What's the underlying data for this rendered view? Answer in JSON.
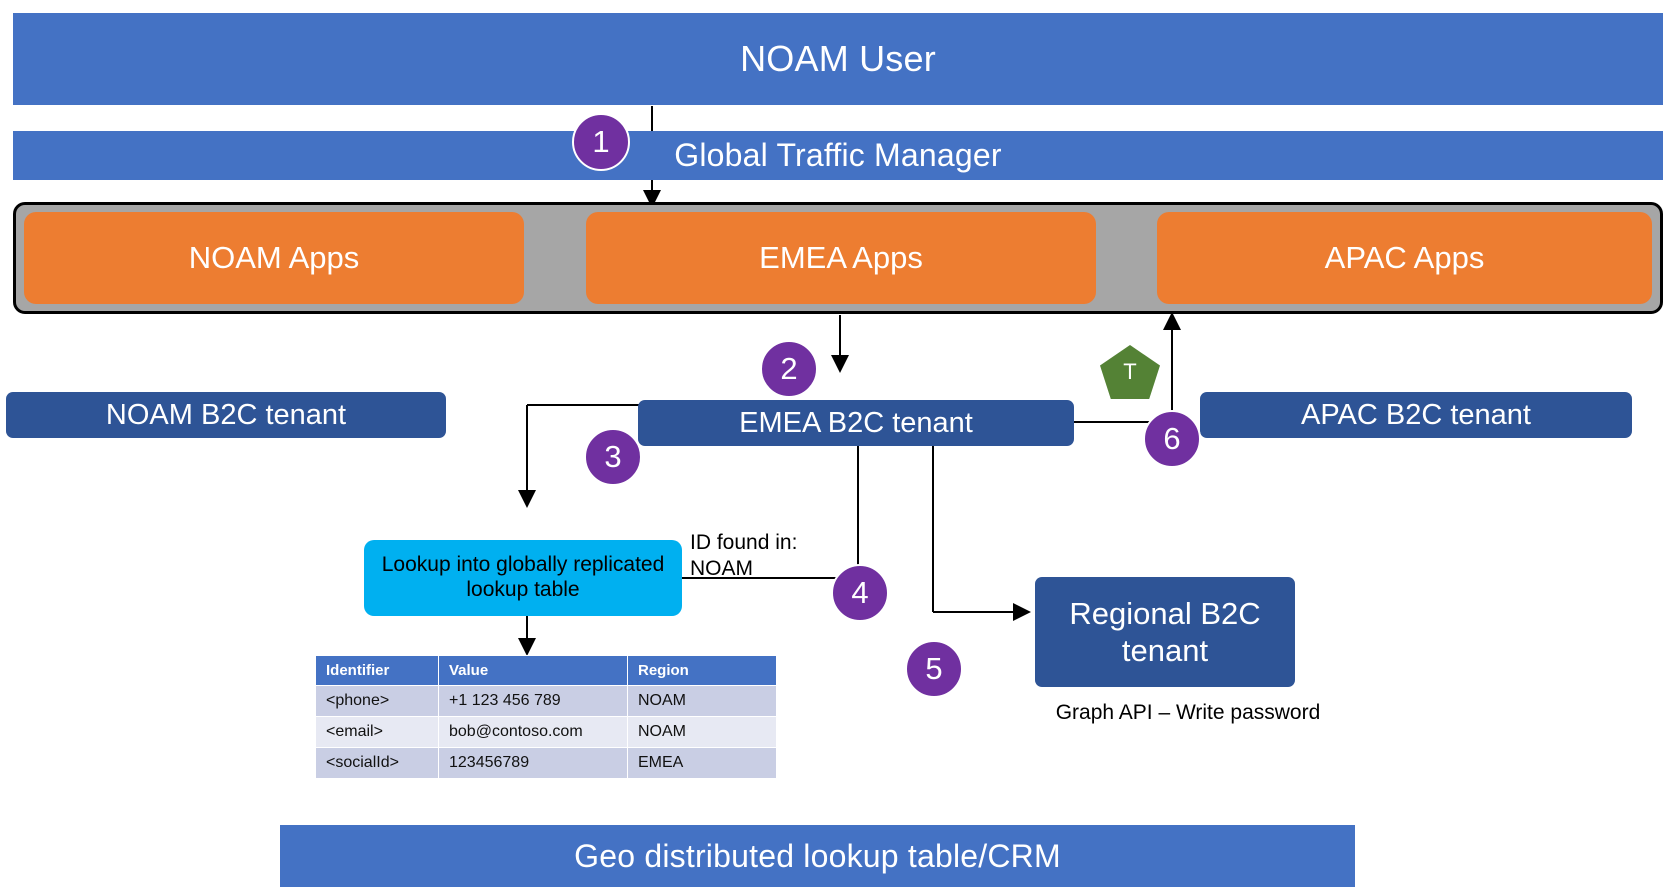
{
  "diagram": {
    "title_bar": {
      "label": "NOAM User"
    },
    "gtm_bar": {
      "label": "Global Traffic Manager"
    },
    "apps": [
      {
        "label": "NOAM Apps"
      },
      {
        "label": "EMEA Apps"
      },
      {
        "label": "APAC Apps"
      }
    ],
    "tenants": [
      {
        "label": "NOAM B2C tenant"
      },
      {
        "label": "EMEA B2C tenant"
      },
      {
        "label": "APAC B2C tenant"
      },
      {
        "label": "Regional B2C tenant"
      }
    ],
    "lookup_box": {
      "label": "Lookup into globally\nreplicated lookup table"
    },
    "annotations": {
      "id_found": "ID found in:\nNOAM",
      "graph_api": "Graph API – Write password",
      "token_marker": "T"
    },
    "steps": [
      {
        "number": "1"
      },
      {
        "number": "2"
      },
      {
        "number": "3"
      },
      {
        "number": "4"
      },
      {
        "number": "5"
      },
      {
        "number": "6"
      }
    ],
    "footer_bar": {
      "label": "Geo distributed lookup table/CRM"
    },
    "table": {
      "columns": [
        "Identifier",
        "Value",
        "Region"
      ],
      "rows": [
        [
          "<phone>",
          "+1 123 456 789",
          "NOAM"
        ],
        [
          "<email>",
          "bob@contoso.com",
          "NOAM"
        ],
        [
          "<socialId>",
          "123456789",
          "EMEA"
        ]
      ]
    },
    "colors": {
      "blue": "#4472C4",
      "dark_blue": "#2E5496",
      "orange": "#ED7D31",
      "gray": "#A6A6A6",
      "purple": "#7030A0",
      "cyan": "#00B0F0",
      "green": "#548235"
    }
  }
}
